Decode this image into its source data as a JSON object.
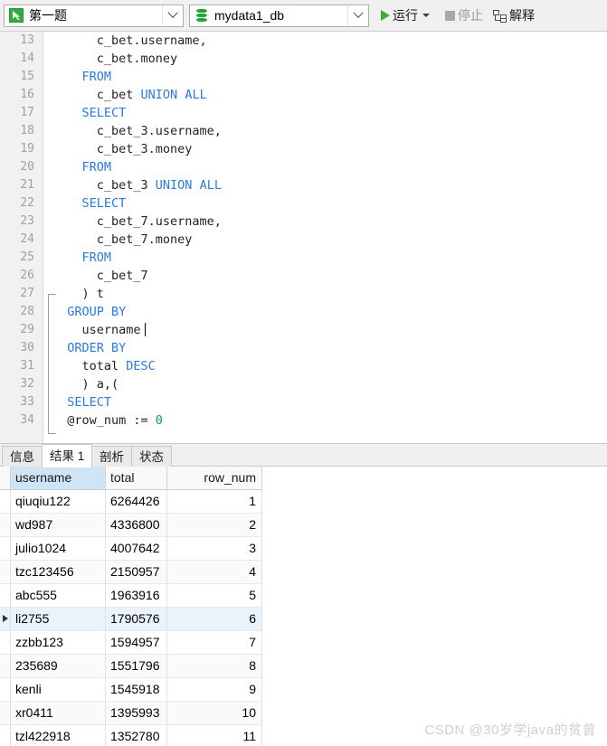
{
  "toolbar": {
    "query_combo": {
      "value": "第一题",
      "icon": "query-file-icon"
    },
    "db_combo": {
      "value": "mydata1_db",
      "icon": "database-icon"
    },
    "run_button": {
      "label": "运行",
      "icon": "play-icon",
      "dropdown_icon": "caret-down-icon"
    },
    "stop_button": {
      "label": "停止",
      "icon": "stop-square-icon",
      "disabled": true
    },
    "explain_button": {
      "label": "解释",
      "icon": "explain-plan-icon"
    }
  },
  "editor": {
    "first_line_number": 13,
    "cursor_line": 29,
    "fold_from_line": 27,
    "fold_to_line": 34,
    "lines": [
      {
        "n": "13",
        "html": "      c_bet.username,"
      },
      {
        "n": "14",
        "html": "      c_bet.money"
      },
      {
        "n": "15",
        "html": "    <k>FROM</k>"
      },
      {
        "n": "16",
        "html": "      c_bet <k>UNION ALL</k>"
      },
      {
        "n": "17",
        "html": "    <k>SELECT</k>"
      },
      {
        "n": "18",
        "html": "      c_bet_3.username,"
      },
      {
        "n": "19",
        "html": "      c_bet_3.money"
      },
      {
        "n": "20",
        "html": "    <k>FROM</k>"
      },
      {
        "n": "21",
        "html": "      c_bet_3 <k>UNION ALL</k>"
      },
      {
        "n": "22",
        "html": "    <k>SELECT</k>"
      },
      {
        "n": "23",
        "html": "      c_bet_7.username,"
      },
      {
        "n": "24",
        "html": "      c_bet_7.money"
      },
      {
        "n": "25",
        "html": "    <k>FROM</k>"
      },
      {
        "n": "26",
        "html": "      c_bet_7"
      },
      {
        "n": "27",
        "html": "    ) t"
      },
      {
        "n": "28",
        "html": "  <k>GROUP BY</k>"
      },
      {
        "n": "29",
        "html": "    username<c></c>"
      },
      {
        "n": "30",
        "html": "  <k>ORDER BY</k>"
      },
      {
        "n": "31",
        "html": "    total <k>DESC</k>"
      },
      {
        "n": "32",
        "html": "    ) a,("
      },
      {
        "n": "33",
        "html": "  <k>SELECT</k>"
      },
      {
        "n": "34",
        "html": "  @row_num := <g>0</g>"
      }
    ]
  },
  "result_tabs": {
    "items": [
      {
        "label": "信息",
        "active": false
      },
      {
        "label": "结果 1",
        "active": true
      },
      {
        "label": "剖析",
        "active": false
      },
      {
        "label": "状态",
        "active": false
      }
    ]
  },
  "result_grid": {
    "columns": [
      "username",
      "total",
      "row_num"
    ],
    "selected_column": "username",
    "current_row_index": 5,
    "rows": [
      {
        "username": "qiuqiu122",
        "total": "6264426",
        "row_num": "1"
      },
      {
        "username": "wd987",
        "total": "4336800",
        "row_num": "2"
      },
      {
        "username": "julio1024",
        "total": "4007642",
        "row_num": "3"
      },
      {
        "username": "tzc123456",
        "total": "2150957",
        "row_num": "4"
      },
      {
        "username": "abc555",
        "total": "1963916",
        "row_num": "5"
      },
      {
        "username": "li2755",
        "total": "1790576",
        "row_num": "6"
      },
      {
        "username": "zzbb123",
        "total": "1594957",
        "row_num": "7"
      },
      {
        "username": "235689",
        "total": "1551796",
        "row_num": "8"
      },
      {
        "username": "kenli",
        "total": "1545918",
        "row_num": "9"
      },
      {
        "username": "xr0411",
        "total": "1395993",
        "row_num": "10"
      },
      {
        "username": "tzl422918",
        "total": "1352780",
        "row_num": "11"
      }
    ]
  },
  "watermark": {
    "text": "CSDN @30岁学java的贫曾"
  },
  "colors": {
    "accent_green": "#31ad3f",
    "keyword_blue": "#2a7ade",
    "number_green": "#0f9d58",
    "selection_blue": "#cfe4f5",
    "current_row_blue": "#eaf3fb",
    "toolbar_bg": "#f0f0f0",
    "gutter_bg": "#f1f1f1"
  }
}
